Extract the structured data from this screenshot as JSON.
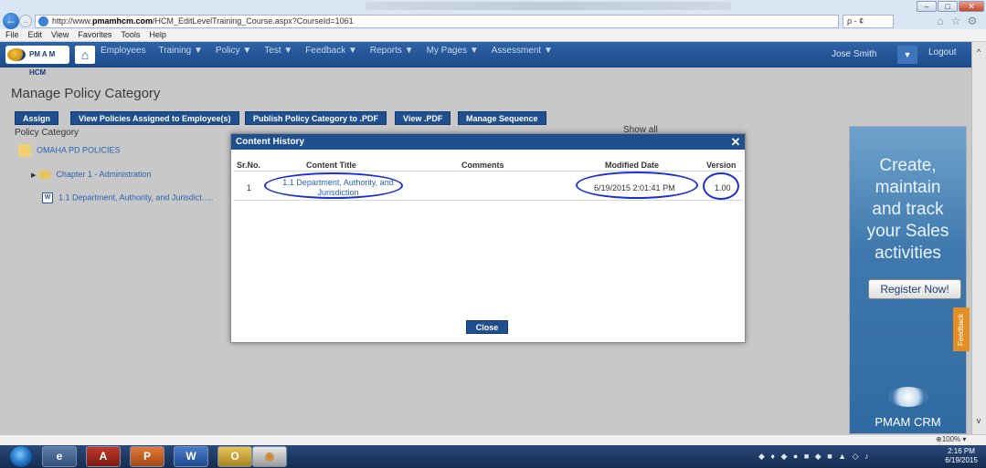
{
  "browser": {
    "url_prefix": "http://www.",
    "url_host": "pmamhcm.com",
    "url_path": "/HCM_EditLevelTraining_Course.aspx?CourseId=1061",
    "search_button": "ρ - ¢",
    "menu": [
      "File",
      "Edit",
      "View",
      "Favorites",
      "Tools",
      "Help"
    ]
  },
  "app": {
    "logo_text": "PM A M HCM",
    "nav": [
      "Employees",
      "Training ▼",
      "Policy ▼",
      "Test ▼",
      "Feedback ▼",
      "Reports ▼",
      "My Pages ▼",
      "Assessment ▼"
    ],
    "user_name": "Jose Smith",
    "logout": "Logout"
  },
  "page": {
    "title": "Manage Policy Category",
    "actions": [
      "Assign",
      "View Policies Assigned to Employee(s)",
      "Publish Policy Category to .PDF",
      "View .PDF",
      "Manage Sequence"
    ],
    "policy_category_label": "Policy Category",
    "show_all": "Show all",
    "tree": {
      "root": "OMAHA PD POLICIES",
      "chapter": "Chapter 1 - Administration",
      "document": "1.1 Department, Authority, and Jurisdict....."
    }
  },
  "modal": {
    "title": "Content History",
    "columns": [
      "Sr.No.",
      "Content Title",
      "Comments",
      "Modified Date",
      "Version"
    ],
    "rows": [
      {
        "srno": "1",
        "title_line1": "1.1 Department, Authority, and",
        "title_line2": "Jurisdiction",
        "comments": "",
        "modified": "6/19/2015 2:01:41 PM",
        "version": "1.00"
      }
    ],
    "close": "Close"
  },
  "ad": {
    "lines": [
      "Create,",
      "maintain",
      "and track",
      "your Sales",
      "activities"
    ],
    "register": "Register Now!",
    "feedback": "Feedback",
    "brand": "PMAM CRM"
  },
  "status": {
    "zoom": "100%"
  },
  "taskbar": {
    "time": "2:16 PM",
    "date": "6/19/2015"
  }
}
